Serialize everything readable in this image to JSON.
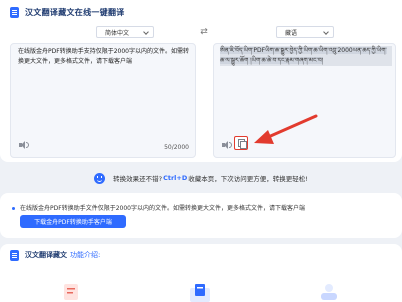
{
  "header": {
    "title": "汉文翻译藏文在线一键翻译"
  },
  "source": {
    "language": "简体中文",
    "text": "在线版金舟PDF转换助手支持仅限于2000字以内的文件。如需转换更大文件，更多格式文件，请下载客户端",
    "char_count": "50/2000"
  },
  "target": {
    "language": "藏语",
    "text": "ཨིན་ཇི་བོད་ཡིག་PDFཡིག་ཆ་སྒྱུར་བྱེད་ཀྱི་ཡིག་ཆ་ཡིག་འབྲུ་2000ཡན་ཆད་ཀྱི་ཡིག་ཆ་ལ་སྒྱུར་ཆོག །ཡིག་ཆ་ཆེ་བ་དང་རྣམ་གཞག་མང་བ།"
  },
  "tip": {
    "prefix": "转换效果还不错?",
    "shortcut": "Ctrl+D",
    "suffix": "收藏本页，下次访问更方便，转换更轻松!"
  },
  "promo": {
    "text": "在线版金舟PDF转换助手文件仅限于2000字以内的文件。如需转换更大文件，更多格式文件，请下载客户端",
    "button_label": "下载金舟PDF转换助手客户端"
  },
  "intro": {
    "title": "汉文翻译藏文",
    "subtitle": "功能介绍:"
  },
  "colors": {
    "accent": "#2f6bff",
    "arrow": "#e23b2e"
  },
  "icons": [
    "doc-icon",
    "swap-icon",
    "speaker-icon",
    "copy-icon",
    "smile-icon"
  ]
}
